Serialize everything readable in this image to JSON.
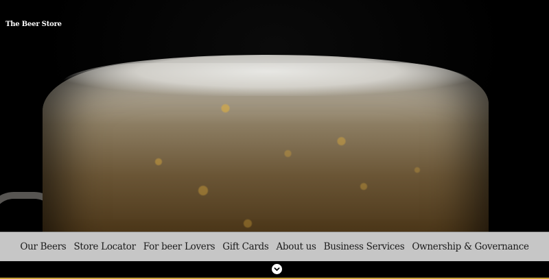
{
  "header": {
    "logo_text": "The Beer Store"
  },
  "hero": {
    "image": "beer-glass-foam"
  },
  "nav": {
    "items": [
      {
        "label": "Our Beers"
      },
      {
        "label": "Store Locator"
      },
      {
        "label": "For beer Lovers"
      },
      {
        "label": "Gift Cards"
      },
      {
        "label": "About us"
      },
      {
        "label": "Business Services"
      },
      {
        "label": "Ownership & Governance"
      }
    ]
  },
  "scroll_button": {
    "icon": "chevron-down-icon"
  },
  "colors": {
    "nav_background": "#c6c6c6",
    "accent_line": "#c7a23a",
    "background": "#000000"
  }
}
